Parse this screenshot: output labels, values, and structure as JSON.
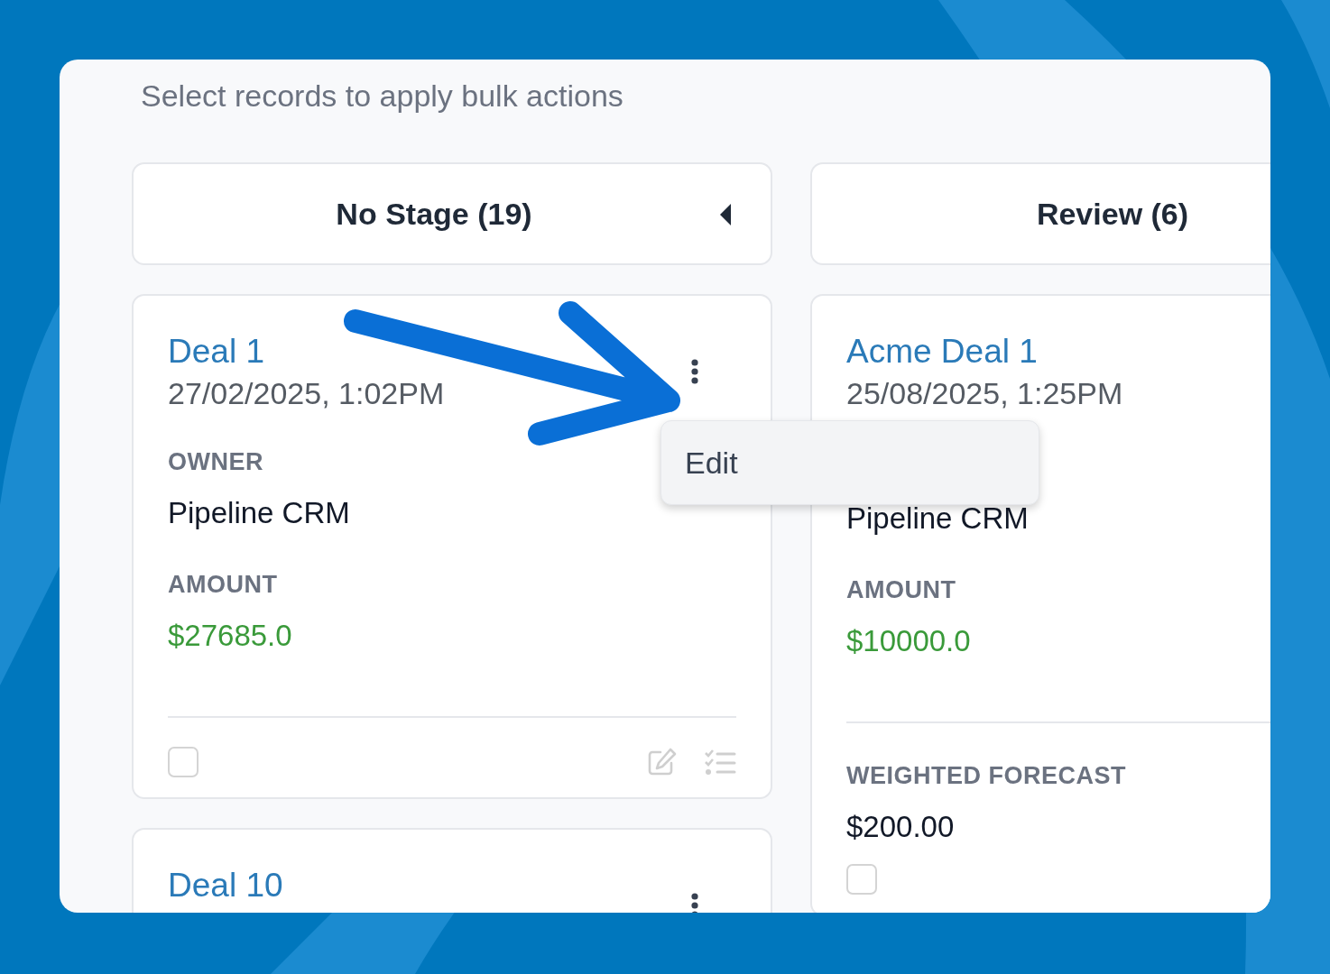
{
  "subtitle": "Select records to apply bulk actions",
  "columns": [
    {
      "title": "No Stage (19)",
      "cards": [
        {
          "title": "Deal 1",
          "date": "27/02/2025, 1:02PM",
          "fields": [
            {
              "label": "OWNER",
              "value": "Pipeline CRM",
              "kind": "text"
            },
            {
              "label": "AMOUNT",
              "value": "$27685.0",
              "kind": "money"
            }
          ],
          "checked": false,
          "menu": {
            "items": [
              {
                "label": "Edit"
              }
            ]
          }
        },
        {
          "title": "Deal 10"
        }
      ]
    },
    {
      "title": "Review (6)",
      "cards": [
        {
          "title": "Acme Deal 1",
          "date": "25/08/2025, 1:25PM",
          "fields": [
            {
              "value": "Pipeline CRM",
              "kind": "text"
            },
            {
              "label": "AMOUNT",
              "value": "$10000.0",
              "kind": "money"
            }
          ],
          "extra_fields": [
            {
              "label": "WEIGHTED FORECAST",
              "value": "$200.00",
              "kind": "text"
            }
          ],
          "checked": false
        }
      ]
    }
  ]
}
